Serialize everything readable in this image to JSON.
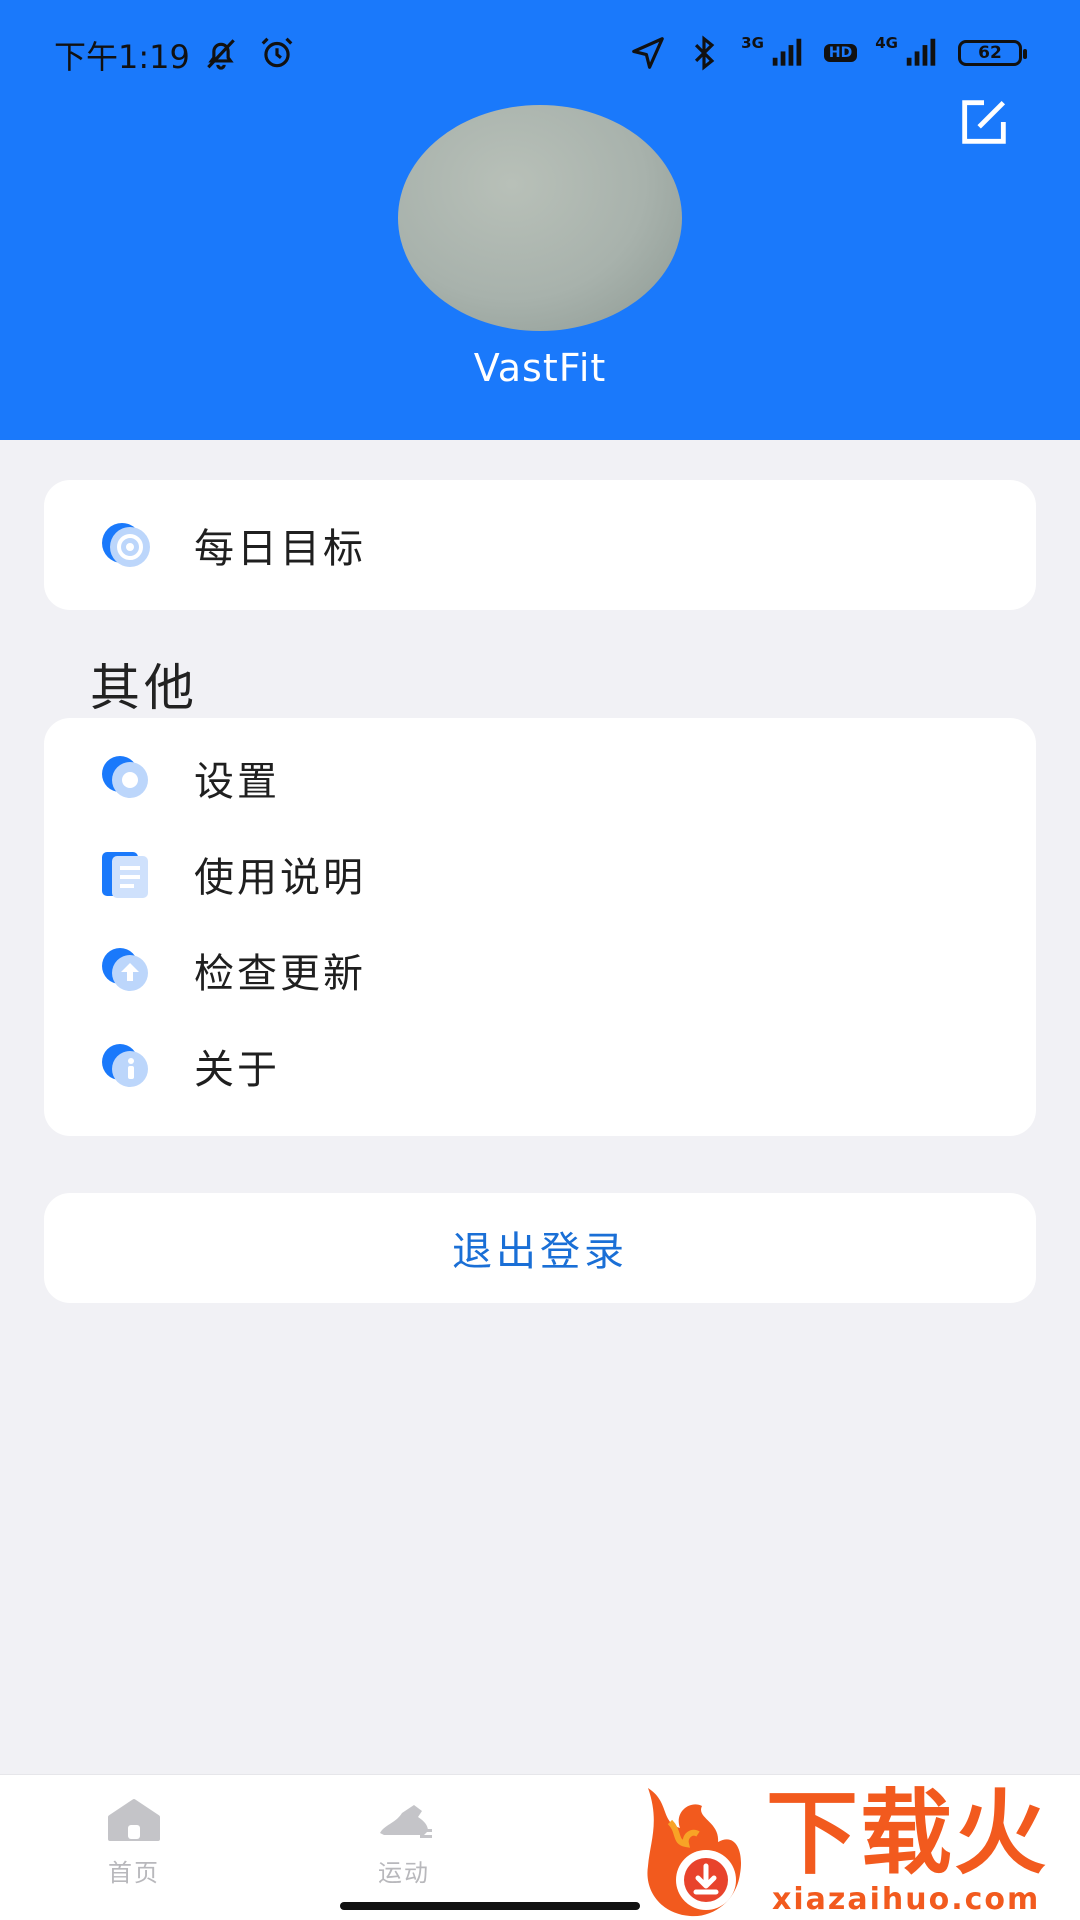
{
  "status_bar": {
    "time": "下午1:19",
    "network_3g": "3G",
    "hd": "HD",
    "network_4g": "4G",
    "battery": "62"
  },
  "profile": {
    "username": "VastFit"
  },
  "goal_card": {
    "label": "每日目标"
  },
  "other_section": {
    "title": "其他",
    "items": [
      {
        "label": "设置",
        "icon": "settings-icon"
      },
      {
        "label": "使用说明",
        "icon": "manual-icon"
      },
      {
        "label": "检查更新",
        "icon": "update-icon"
      },
      {
        "label": "关于",
        "icon": "info-icon"
      }
    ]
  },
  "logout": {
    "label": "退出登录"
  },
  "tabbar": {
    "tabs": [
      {
        "label": "首页",
        "icon": "home-icon"
      },
      {
        "label": "运动",
        "icon": "sport-shoe-icon"
      }
    ]
  },
  "watermark": {
    "text": "下载火",
    "url": "xiazaihuo.com"
  },
  "colors": {
    "header": "#1a79fb",
    "accent": "#1a6fd6",
    "background": "#f1f1f5",
    "watermark": "#f25a1e"
  }
}
